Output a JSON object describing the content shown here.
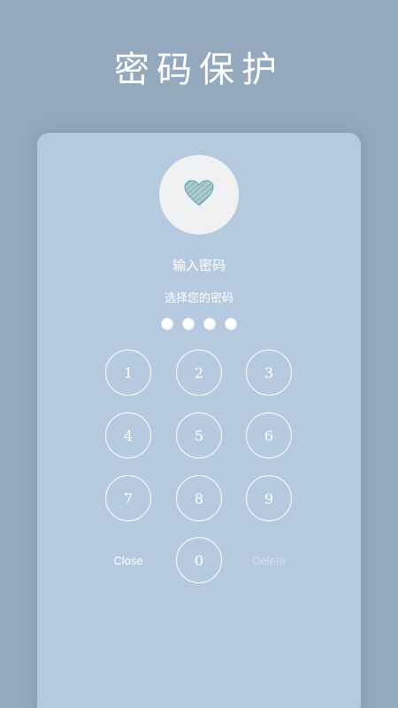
{
  "banner": {
    "title": "密码保护"
  },
  "lock_screen": {
    "heading": "输入密码",
    "subheading": "选择您的密码",
    "avatar_icon": "heart-icon",
    "pin_dots_filled": 0,
    "pin_dots_total": 4,
    "keypad": {
      "keys": [
        "1",
        "2",
        "3",
        "4",
        "5",
        "6",
        "7",
        "8",
        "9",
        "0"
      ],
      "close_label": "Close",
      "delete_label": "Delete"
    }
  },
  "colors": {
    "background": "#94a9bd",
    "card": "#b6cadf",
    "text": "#ffffff",
    "delete_disabled": "#d3deea"
  }
}
